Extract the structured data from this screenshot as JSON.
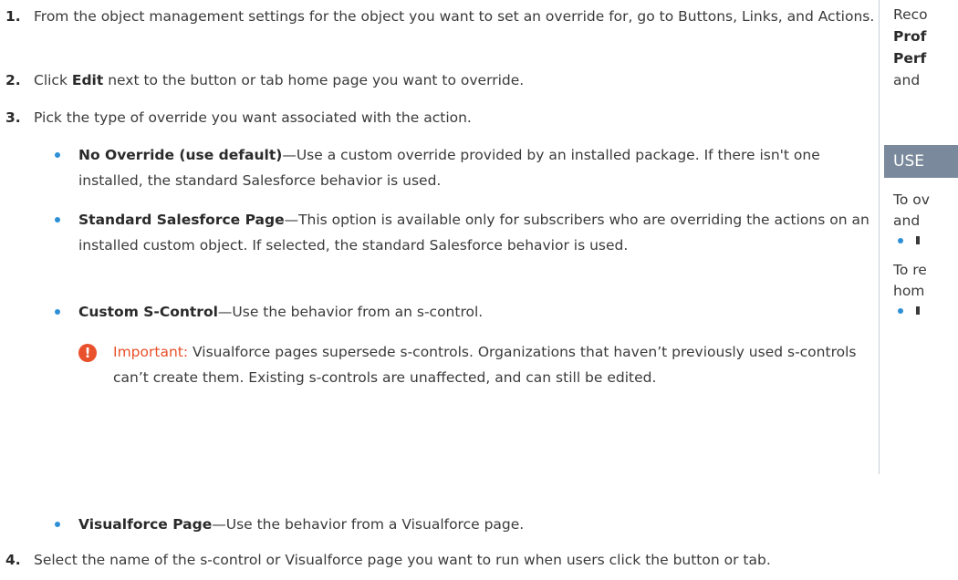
{
  "steps": [
    {
      "num": "1.",
      "text": "From the object management settings for the object you want to set an override for, go to Buttons, Links, and Actions."
    },
    {
      "num": "2.",
      "pre": "Click ",
      "bold": "Edit",
      "post": " next to the button or tab home page you want to override."
    },
    {
      "num": "3.",
      "text": "Pick the type of override you want associated with the action."
    },
    {
      "num": "4.",
      "text": "Select the name of the s-control or Visualforce page you want to run when users click the button or tab."
    }
  ],
  "options": [
    {
      "title": "No Override (use default)",
      "desc": "—Use a custom override provided by an installed package. If there isn't one installed, the standard Salesforce behavior is used."
    },
    {
      "title": "Standard Salesforce Page",
      "desc": "—This option is available only for subscribers who are overriding the actions on an installed custom object. If selected, the standard Salesforce behavior is used."
    },
    {
      "title": "Custom S-Control",
      "desc": "—Use the behavior from an s-control."
    },
    {
      "title": "Visualforce Page",
      "desc": "—Use the behavior from a Visualforce page."
    }
  ],
  "important": {
    "label": "Important:",
    "text": " Visualforce pages supersede s-controls. Organizations that haven’t previously used s-controls can’t create them. Existing s-controls are unaffected, and can still be edited."
  },
  "sidebar": {
    "line1": "Reco",
    "line2": "Prof",
    "line3": "Perf",
    "line4": "and",
    "header": "USE",
    "line5": "To ov",
    "line6": "and",
    "line7": "To re",
    "line8": "hom"
  },
  "colors": {
    "accent": "#2d8fd5",
    "warning": "#e8512b",
    "sidebar_header": "#7a8a9c"
  }
}
